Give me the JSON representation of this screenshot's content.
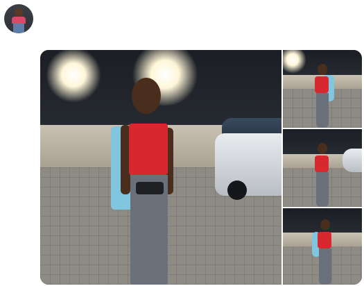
{
  "tweet": {
    "display_name": "",
    "handle": "",
    "separator": "",
    "time": "",
    "text": ""
  },
  "media": {
    "count": 4,
    "icons": [
      "photo-main",
      "photo-thumb-1",
      "photo-thumb-2",
      "photo-thumb-3"
    ]
  },
  "colors": {
    "handle_gray": "#657786",
    "text_dark": "#14171a",
    "top_red": "#d8282f",
    "jacket_blue": "#7fc6de"
  }
}
